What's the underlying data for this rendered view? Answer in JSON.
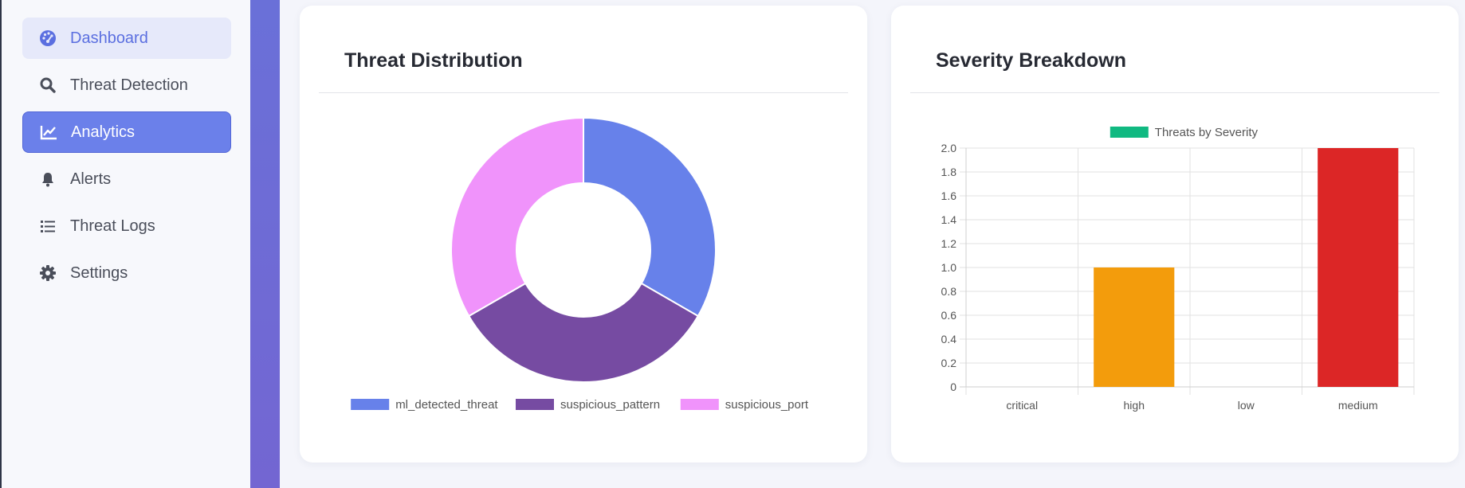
{
  "sidebar": {
    "items": [
      {
        "label": "Dashboard",
        "icon": "dashboard-gauge-icon"
      },
      {
        "label": "Threat Detection",
        "icon": "search-icon"
      },
      {
        "label": "Analytics",
        "icon": "line-chart-icon"
      },
      {
        "label": "Alerts",
        "icon": "bell-icon"
      },
      {
        "label": "Threat Logs",
        "icon": "list-icon"
      },
      {
        "label": "Settings",
        "icon": "gear-icon"
      }
    ],
    "active_item": "Analytics",
    "hover_item": "Dashboard"
  },
  "cards": {
    "distribution": {
      "title": "Threat Distribution"
    },
    "severity": {
      "title": "Severity Breakdown"
    }
  },
  "chart_data": [
    {
      "type": "pie",
      "variant": "doughnut",
      "title": "Threat Distribution",
      "labels": [
        "ml_detected_threat",
        "suspicious_pattern",
        "suspicious_port"
      ],
      "values": [
        1,
        1,
        1
      ],
      "colors": [
        "#6781ea",
        "#764ba2",
        "#f093fb"
      ],
      "legend_position": "bottom"
    },
    {
      "type": "bar",
      "title": "Severity Breakdown",
      "categories": [
        "critical",
        "high",
        "low",
        "medium"
      ],
      "series": [
        {
          "name": "Threats by Severity",
          "values": [
            0,
            1,
            0,
            2
          ],
          "colors": [
            "#dc2626",
            "#f39c0c",
            "#10b981",
            "#dc2626"
          ]
        }
      ],
      "legend_color": "#10b981",
      "legend_position": "top",
      "ylim": [
        0,
        2.0
      ],
      "yticks": [
        "0",
        "0.2",
        "0.4",
        "0.6",
        "0.8",
        "1.0",
        "1.2",
        "1.4",
        "1.6",
        "1.8",
        "2.0"
      ],
      "grid": true
    }
  ]
}
